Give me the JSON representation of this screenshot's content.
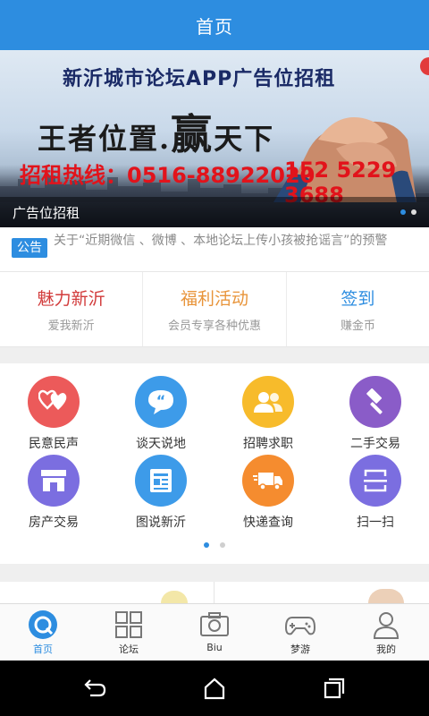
{
  "header": {
    "title": "首页"
  },
  "banner": {
    "headline": "新沂城市论坛APP广告位招租",
    "slogan_a": "王者位置.",
    "slogan_b": "赢",
    "slogan_c": "天下",
    "hotline": "招租热线：0516-88922020",
    "mobile": "152 5229 3688",
    "caption": "广告位招租"
  },
  "notice": {
    "tag": "公告",
    "text": "关于“近期微信 、微博 、本地论坛上传小孩被抢谣言”的预警"
  },
  "features": [
    {
      "title": "魅力新沂",
      "subtitle": "爱我新沂",
      "color": "#d23b3b"
    },
    {
      "title": "福利活动",
      "subtitle": "会员专享各种优惠",
      "color": "#e8943a"
    },
    {
      "title": "签到",
      "subtitle": "赚金币",
      "color": "#2d8de0"
    }
  ],
  "grid": [
    {
      "label": "民意民声",
      "icon": "hearts-icon",
      "color": "#ec5a5a"
    },
    {
      "label": "谈天说地",
      "icon": "chat-quote-icon",
      "color": "#3d9be9"
    },
    {
      "label": "招聘求职",
      "icon": "people-icon",
      "color": "#f7bb2b"
    },
    {
      "label": "二手交易",
      "icon": "hammer-icon",
      "color": "#8a5cc8"
    },
    {
      "label": "房产交易",
      "icon": "shop-icon",
      "color": "#7b6ee0"
    },
    {
      "label": "图说新沂",
      "icon": "news-icon",
      "color": "#3d9be9"
    },
    {
      "label": "快递查询",
      "icon": "truck-icon",
      "color": "#f58c2f"
    },
    {
      "label": "扫一扫",
      "icon": "scan-icon",
      "color": "#7b6ee0"
    }
  ],
  "tabs": [
    {
      "label": "首页",
      "icon": "home-icon",
      "active": true
    },
    {
      "label": "论坛",
      "icon": "grid-icon",
      "active": false
    },
    {
      "label": "Biu",
      "icon": "camera-icon",
      "active": false
    },
    {
      "label": "梦游",
      "icon": "gamepad-icon",
      "active": false
    },
    {
      "label": "我的",
      "icon": "user-icon",
      "active": false
    }
  ],
  "colors": {
    "primary": "#2d8de0",
    "background": "#efefef"
  }
}
